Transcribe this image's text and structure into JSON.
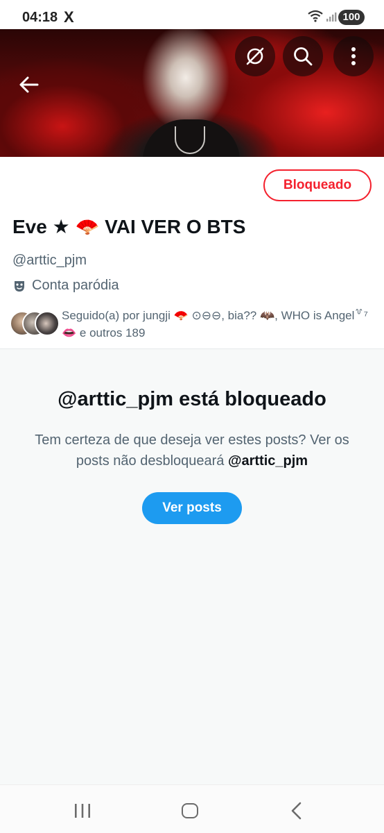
{
  "status_bar": {
    "time": "04:18",
    "app_icon": "X",
    "battery": "100"
  },
  "banner": {
    "back_icon": "arrow-left-icon",
    "grok_icon": "grok-icon",
    "search_icon": "search-icon",
    "more_icon": "more-vertical-icon"
  },
  "profile": {
    "blocked_label": "Bloqueado",
    "display_name": "Eve ★ 🪭 VAI VER O BTS",
    "handle": "@arttic_pjm",
    "parody_label": "Conta paródia",
    "followed_by": "Seguido(a) por jungji 🪭 ⊙⊖⊖, bia?? 🦇, WHO is Angel꒷⁷ 👄 e outros 189"
  },
  "blocked_notice": {
    "title": "@arttic_pjm está bloqueado",
    "description": "Tem certeza de que deseja ver estes posts? Ver os posts não desbloqueará ",
    "description_handle": "@arttic_pjm",
    "button_label": "Ver posts"
  },
  "colors": {
    "blocked_red": "#f4212e",
    "accent_blue": "#1d9bf0",
    "secondary_text": "#536471"
  }
}
